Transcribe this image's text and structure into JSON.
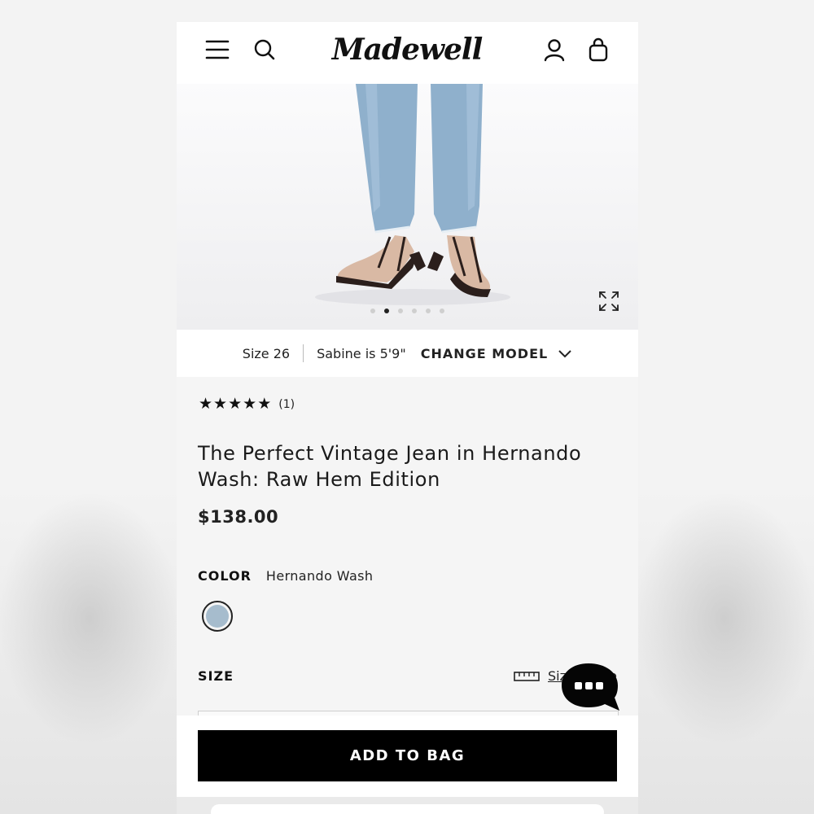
{
  "header": {
    "brand": "Madewell",
    "menu_icon": "hamburger-menu-icon",
    "search_icon": "search-icon",
    "account_icon": "user-account-icon",
    "bag_icon": "shopping-bag-icon"
  },
  "gallery": {
    "image_count": 6,
    "active_index": 1,
    "expand_icon": "expand-icon"
  },
  "model_info": {
    "size": "Size 26",
    "model_height": "Sabine is 5'9\"",
    "change_label": "CHANGE MODEL",
    "change_icon": "chevron-down-icon"
  },
  "product": {
    "rating": 5,
    "review_count": "(1)",
    "title": "The Perfect Vintage Jean in Hernando Wash: Raw Hem Edition",
    "price": "$138.00"
  },
  "color": {
    "label": "COLOR",
    "value": "Hernando Wash",
    "swatch_color": "#a6bccd"
  },
  "size": {
    "label": "SIZE",
    "guide_label": "Size Guide",
    "guide_icon": "ruler-icon"
  },
  "chat": {
    "icon": "chat-bubble-icon"
  },
  "cta": {
    "add_to_bag": "ADD TO BAG"
  }
}
